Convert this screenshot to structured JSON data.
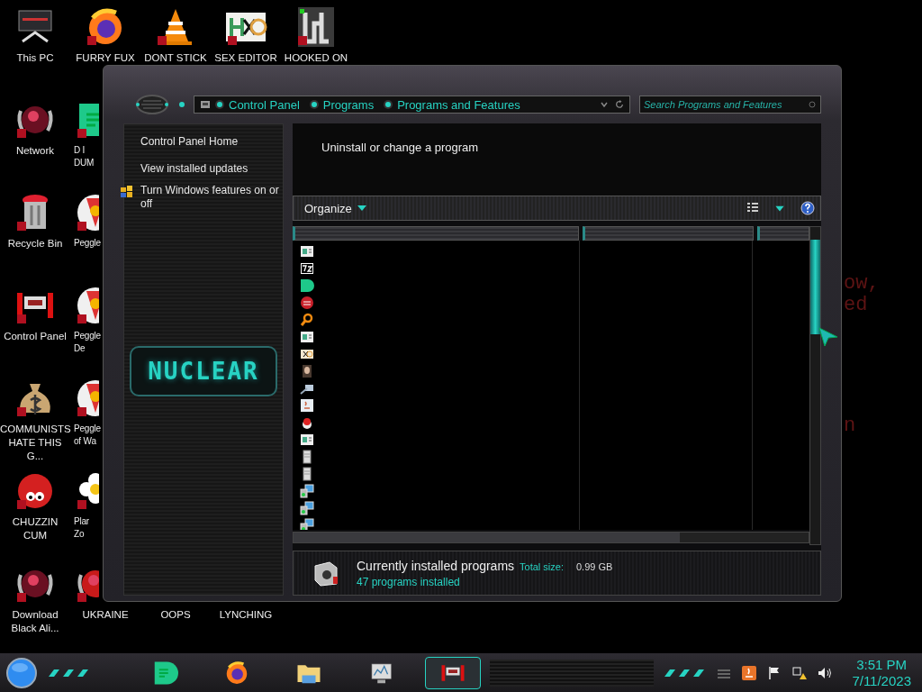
{
  "wallpaper_text": [
    "ow,",
    "ed",
    "n"
  ],
  "desktop_rows": [
    [
      {
        "label": "This PC",
        "kind": "monitor"
      },
      {
        "label": "FURRY FUX",
        "kind": "firefox"
      },
      {
        "label": "DONT STICK",
        "kind": "cone"
      },
      {
        "label": "SEX EDITOR",
        "kind": "hex"
      },
      {
        "label": "HOOKED ON",
        "kind": "maze"
      }
    ],
    [
      {
        "label": "Network",
        "kind": "orb"
      },
      {
        "label": "D I\nDUM",
        "kind": "chat",
        "partly_hidden": true
      }
    ],
    [
      {
        "label": "Recycle Bin",
        "kind": "trash"
      },
      {
        "label": "Peggle",
        "kind": "peggle",
        "partly_hidden": true
      }
    ],
    [
      {
        "label": "Control Panel",
        "kind": "cp"
      },
      {
        "label": "Peggle\nDe",
        "kind": "peggle",
        "partly_hidden": true
      }
    ],
    [
      {
        "label": "COMMUNISTS HATE THIS G...",
        "kind": "money"
      },
      {
        "label": "Peggle\nof Wa",
        "kind": "peggle",
        "partly_hidden": true
      }
    ],
    [
      {
        "label": "CHUZZIN CUM",
        "kind": "fuzz"
      },
      {
        "label": "Plar\nZo",
        "kind": "flower",
        "partly_hidden": true
      }
    ],
    [
      {
        "label": "Download Black Ali...",
        "kind": "orb"
      },
      {
        "label": "UKRAINE",
        "kind": "redorb"
      },
      {
        "label": "OOPS",
        "kind": "none"
      },
      {
        "label": "LYNCHING",
        "kind": "none"
      }
    ]
  ],
  "window": {
    "breadcrumbs": [
      "Control Panel",
      "Programs",
      "Programs and Features"
    ],
    "search": {
      "placeholder": "Search Programs and Features"
    },
    "sidebar": {
      "links": [
        {
          "label": "Control Panel Home",
          "kind": "home"
        },
        {
          "label": "View installed updates",
          "kind": "link"
        },
        {
          "label": "Turn Windows features on or off",
          "kind": "shield"
        }
      ],
      "logo": "NUCLEAR"
    },
    "heading": "Uninstall or change a program",
    "toolbar": {
      "organize": "Organize"
    },
    "details": {
      "title": "Currently installed programs",
      "size_label": "Total size:",
      "size": "0.99 GB",
      "count": "47 programs installed"
    }
  },
  "taskbar": {
    "items": [
      {
        "kind": "chat",
        "selected": false
      },
      {
        "kind": "firefox",
        "selected": false
      },
      {
        "kind": "folder",
        "selected": false
      },
      {
        "kind": "monitor",
        "selected": false
      },
      {
        "kind": "cp",
        "selected": true
      }
    ],
    "clock": {
      "time": "3:51 PM",
      "date": "7/11/2023"
    }
  }
}
